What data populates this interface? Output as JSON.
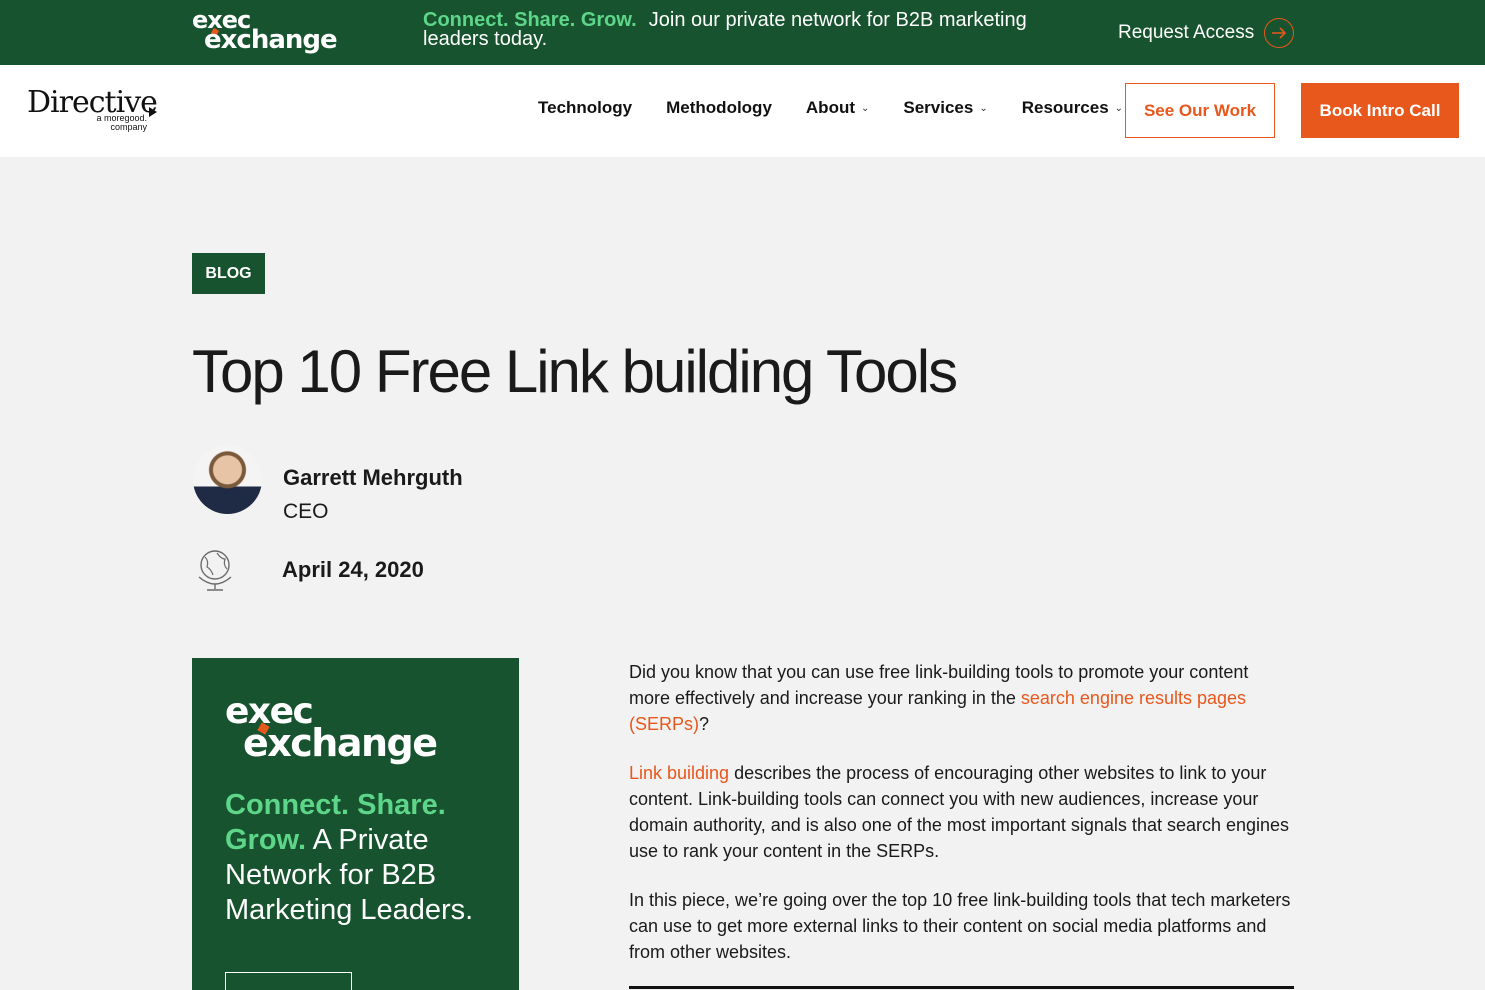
{
  "banner": {
    "logo_line1": "exec",
    "logo_line2": "exchange",
    "tagline": "Connect. Share. Grow.",
    "text": "Join our private network for B2B marketing leaders today.",
    "cta": "Request Access"
  },
  "nav": {
    "brand_name": "Directive",
    "brand_sub": "a moregood. company",
    "links": [
      {
        "label": "Technology",
        "has_dropdown": false
      },
      {
        "label": "Methodology",
        "has_dropdown": false
      },
      {
        "label": "About",
        "has_dropdown": true
      },
      {
        "label": "Services",
        "has_dropdown": true
      },
      {
        "label": "Resources",
        "has_dropdown": true
      }
    ],
    "see_work": "See Our Work",
    "book_call": "Book Intro Call"
  },
  "article": {
    "category": "BLOG",
    "title": "Top 10 Free Link building Tools",
    "author_name": "Garrett Mehrguth",
    "author_role": "CEO",
    "date": "April 24, 2020",
    "p1_a": "Did you know that you can use free link-building tools to promote your content more effectively and increase your ranking in the ",
    "p1_link": "search engine results pages (SERPs)",
    "p1_b": "?",
    "p2_link": "Link building",
    "p2_b": " describes the process of encouraging other websites to link to your content. Link-building tools can connect you with new audiences, increase your domain authority, and is also one of the most important signals that search engines use to rank your content in the SERPs.",
    "p3": "In this piece, we’re going over the top 10 free link-building tools that tech marketers can use to get more external links to their content on social media platforms and from other websites."
  },
  "ad": {
    "logo_line1": "exec",
    "logo_line2": "exchange",
    "tagline": "Connect. Share. Grow.",
    "text": " A Private Network for B2B Marketing Leaders."
  },
  "colors": {
    "brand_green": "#17532e",
    "accent_green": "#5ed68a",
    "accent_orange": "#e8571b",
    "page_bg": "#f2f2f2"
  }
}
